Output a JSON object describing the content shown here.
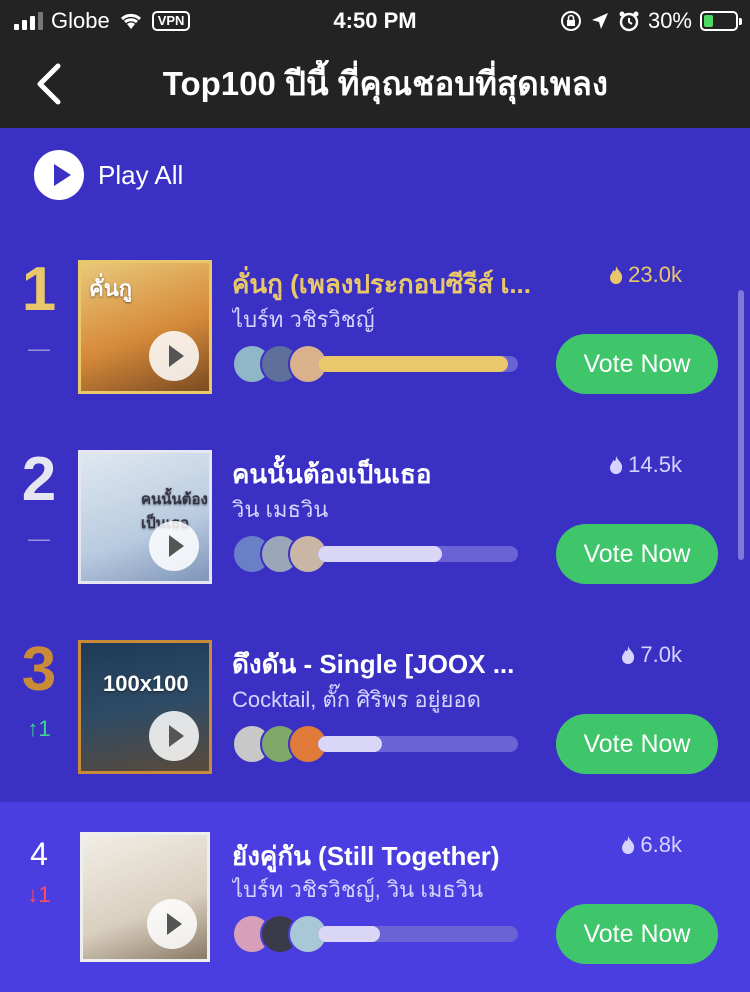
{
  "status_bar": {
    "carrier": "Globe",
    "vpn": "VPN",
    "time": "4:50 PM",
    "battery": "30%"
  },
  "nav": {
    "title": "Top100 ปีนี้ ที่คุณชอบที่สุดเพลง"
  },
  "play_all": {
    "label": "Play All"
  },
  "colors": {
    "background": "#3b30c4",
    "highlight_row": "#4a3ee0",
    "gold": "#e8c86a",
    "bronze": "#c98a3a",
    "vote_green": "#3fc66b",
    "up": "#3ed68a",
    "down": "#ff4d5e"
  },
  "songs": [
    {
      "rank": "1",
      "trend": "—",
      "title": "คั่นกู (เพลงประกอบซีรีส์ เ...",
      "artist": "ไบร์ท วชิรวิชญ์",
      "hot": "23.0k",
      "vote_label": "Vote Now",
      "cover_text": "คั่นกู",
      "progress": 0.95
    },
    {
      "rank": "2",
      "trend": "—",
      "title": "คนนั้นต้องเป็นเธอ",
      "artist": "วิน เมธวิน",
      "hot": "14.5k",
      "vote_label": "Vote Now",
      "cover_text": "คนนั้นต้องเป็นเธอ",
      "progress": 0.62
    },
    {
      "rank": "3",
      "trend": "↑1",
      "title": "ดึงดัน - Single [JOOX ...",
      "artist": "Cocktail, ตั๊ก ศิริพร อยู่ยอด",
      "hot": "7.0k",
      "vote_label": "Vote Now",
      "cover_text": "100x100",
      "progress": 0.32
    },
    {
      "rank": "4",
      "trend": "↓1",
      "title": "ยังคู่กัน (Still Together)",
      "artist": "ไบร์ท วชิรวิชญ์, วิน เมธวิน",
      "hot": "6.8k",
      "vote_label": "Vote Now",
      "cover_text": "",
      "progress": 0.31
    }
  ]
}
